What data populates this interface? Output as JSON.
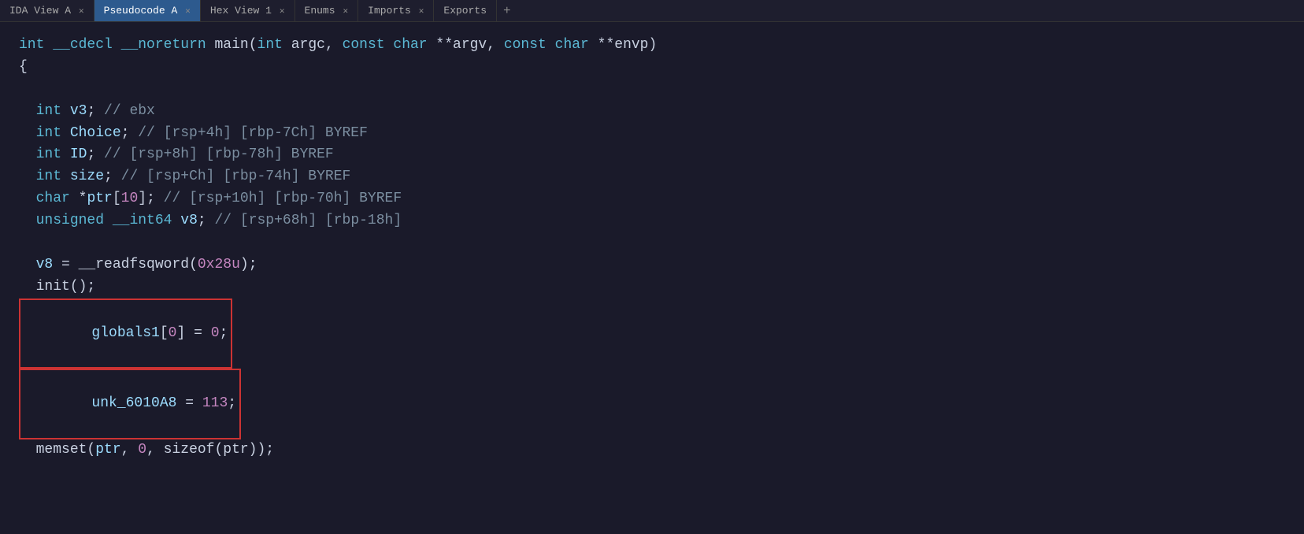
{
  "tabs": [
    {
      "label": "IDA View A",
      "active": false
    },
    {
      "label": "Pseudocode A",
      "active": true
    },
    {
      "label": "Hex View 1",
      "active": false
    },
    {
      "label": "Enums",
      "active": false
    },
    {
      "label": "Imports",
      "active": false
    },
    {
      "label": "Exports",
      "active": false
    }
  ],
  "code": {
    "signature": "int __cdecl __noreturn main(int argc, const char **argv, const char **envp)",
    "open_brace": "{",
    "vars": [
      "  int v3; // ebx",
      "  int Choice; // [rsp+4h] [rbp-7Ch] BYREF",
      "  int ID; // [rsp+8h] [rbp-78h] BYREF",
      "  int size; // [rsp+Ch] [rbp-74h] BYREF",
      "  char *ptr[10]; // [rsp+10h] [rbp-70h] BYREF",
      "  unsigned __int64 v8; // [rsp+68h] [rbp-18h]"
    ],
    "body": [
      "  v8 = __readfsqword(0x28u);",
      "  init();"
    ],
    "highlighted1": "  globals1[0] = 0;",
    "highlighted2": "  unk_6010A8 = 113;",
    "after": "  memset(ptr, 0, sizeof(ptr));"
  }
}
